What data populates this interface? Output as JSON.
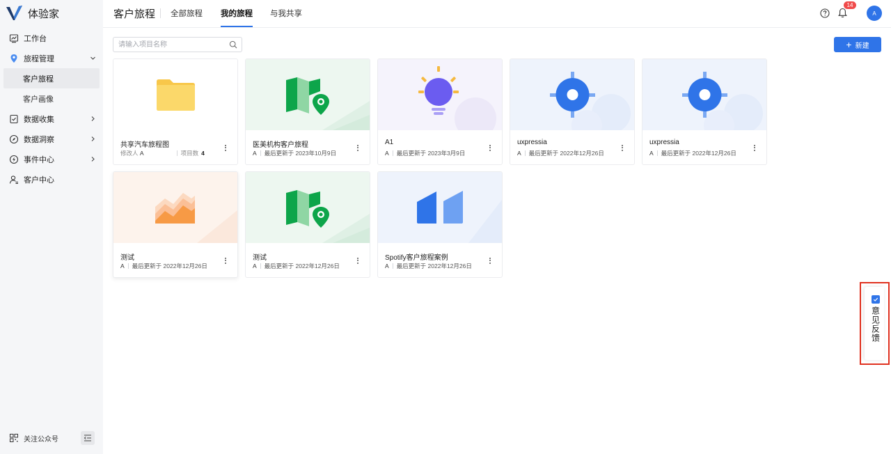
{
  "app": {
    "name": "体验家"
  },
  "sidebar": {
    "items": [
      {
        "label": "工作台",
        "icon": "chart-icon",
        "expandable": false
      },
      {
        "label": "旅程管理",
        "icon": "map-pin-icon",
        "expandable": true,
        "expanded": true,
        "children": [
          {
            "label": "客户旅程",
            "active": true
          },
          {
            "label": "客户画像",
            "active": false
          }
        ]
      },
      {
        "label": "数据收集",
        "icon": "document-check-icon",
        "expandable": true
      },
      {
        "label": "数据洞察",
        "icon": "compass-icon",
        "expandable": true
      },
      {
        "label": "事件中心",
        "icon": "lightning-icon",
        "expandable": true
      },
      {
        "label": "客户中心",
        "icon": "user-icon",
        "expandable": false
      }
    ],
    "footer": {
      "label": "关注公众号",
      "icon": "qr-code-icon",
      "collapse_icon": "collapse-menu-icon"
    }
  },
  "header": {
    "title": "客户旅程",
    "tabs": [
      {
        "label": "全部旅程",
        "active": false
      },
      {
        "label": "我的旅程",
        "active": true
      },
      {
        "label": "与我共享",
        "active": false
      }
    ],
    "notification_count": "14",
    "avatar_initial": "A"
  },
  "toolbar": {
    "search_placeholder": "请输入项目名称",
    "search_value": "",
    "new_button_label": "新建"
  },
  "cards": [
    {
      "name": "共享汽车旅程图",
      "thumbnail": "folder-icon",
      "meta_type": "folder",
      "modifier_label": "修改人",
      "author": "A",
      "count_label": "项目数",
      "count": "4"
    },
    {
      "name": "医美机构客户旅程",
      "thumbnail": "map-icon-green",
      "author": "A",
      "updated": "最后更新于 2023年10月9日"
    },
    {
      "name": "A1",
      "thumbnail": "lightbulb-icon-purple",
      "author": "A",
      "updated": "最后更新于 2023年3月9日"
    },
    {
      "name": "uxpressia",
      "thumbnail": "target-icon-blue",
      "author": "A",
      "updated": "最后更新于 2022年12月26日"
    },
    {
      "name": "uxpressia",
      "thumbnail": "target-icon-blue",
      "author": "A",
      "updated": "最后更新于 2022年12月26日"
    },
    {
      "name": "测试",
      "thumbnail": "area-chart-icon-orange",
      "author": "A",
      "updated": "最后更新于 2022年12月26日"
    },
    {
      "name": "测试",
      "thumbnail": "map-icon-green",
      "author": "A",
      "updated": "最后更新于 2022年12月26日"
    },
    {
      "name": "Spotify客户旅程案例",
      "thumbnail": "bars-icon-blue",
      "author": "A",
      "updated": "最后更新于 2022年12月26日"
    }
  ],
  "feedback": {
    "label": "意见反馈"
  },
  "colors": {
    "accent": "#2f74e8",
    "badge": "#f04b4b",
    "highlight_border": "#e0301e"
  }
}
